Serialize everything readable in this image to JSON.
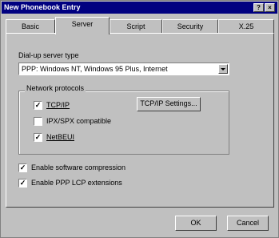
{
  "window": {
    "title": "New Phonebook Entry",
    "help_glyph": "?",
    "close_glyph": "×"
  },
  "tabs": [
    {
      "label": "Basic",
      "active": false
    },
    {
      "label": "Server",
      "active": true
    },
    {
      "label": "Script",
      "active": false
    },
    {
      "label": "Security",
      "active": false
    },
    {
      "label": "X.25",
      "active": false
    }
  ],
  "server": {
    "dialup_label": "Dial-up server type",
    "dialup_value": "PPP: Windows NT, Windows 95 Plus, Internet",
    "protocols_label": "Network protocols",
    "tcpip_label": "TCP/IP",
    "tcpip_checked": true,
    "ipx_label": "IPX/SPX compatible",
    "ipx_checked": false,
    "netbeui_label": "NetBEUI",
    "netbeui_checked": true,
    "tcpip_settings_label": "TCP/IP Settings...",
    "compression_label": "Enable software compression",
    "compression_checked": true,
    "lcp_label": "Enable PPP LCP extensions",
    "lcp_checked": true
  },
  "footer": {
    "ok_label": "OK",
    "cancel_label": "Cancel"
  }
}
